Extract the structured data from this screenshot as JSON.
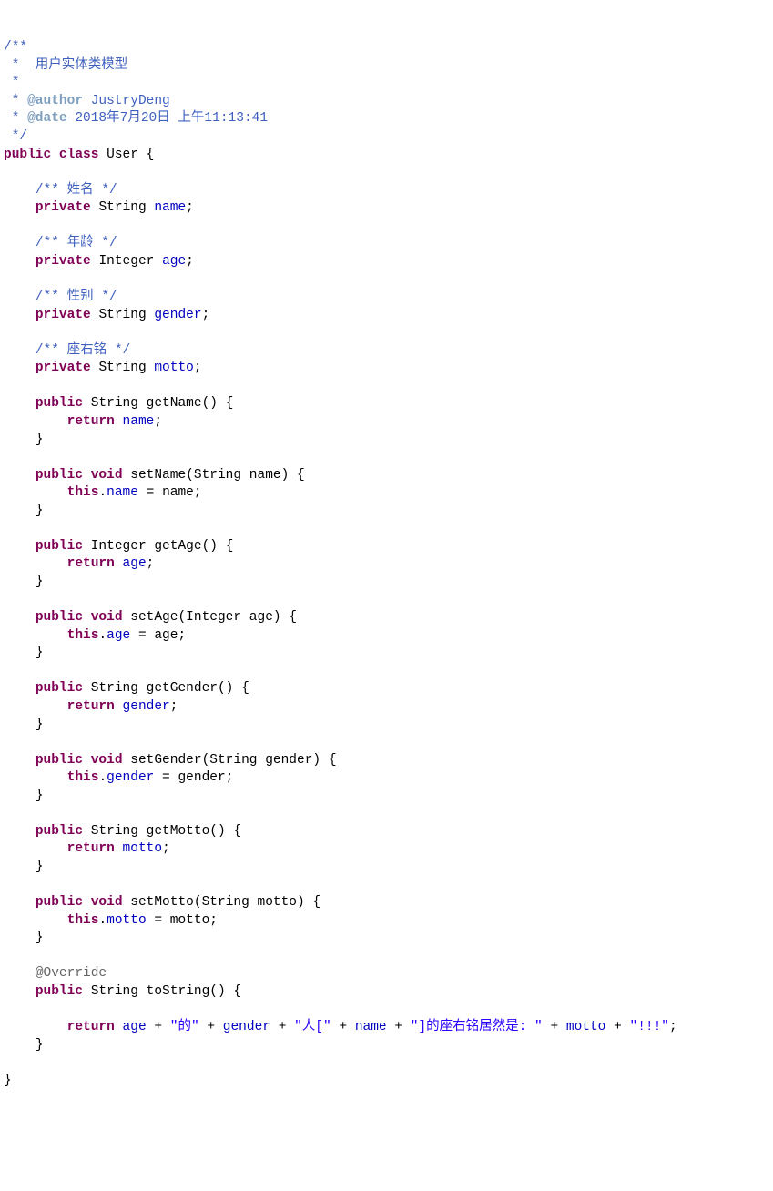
{
  "doc": {
    "open": "/**",
    "desc": " *  用户实体类模型",
    "blank": " *",
    "authorTag": "@author",
    "authorVal": " JustryDeng",
    "dateTag": "@date",
    "dateVal": " 2018年7月20日 上午11:13:41",
    "close": " */"
  },
  "kw": {
    "public": "public",
    "class": "class",
    "private": "private",
    "void": "void",
    "return": "return",
    "this": "this"
  },
  "cls": "User",
  "types": {
    "String": "String",
    "Integer": "Integer"
  },
  "fields": {
    "nameComment": "/** 姓名 */",
    "name": "name",
    "ageComment": "/** 年龄 */",
    "age": "age",
    "genderComment": "/** 性别 */",
    "gender": "gender",
    "mottoComment": "/** 座右铭 */",
    "motto": "motto"
  },
  "methods": {
    "getName": "getName",
    "setName": "setName",
    "getAge": "getAge",
    "setAge": "setAge",
    "getGender": "getGender",
    "setGender": "setGender",
    "getMotto": "getMotto",
    "setMotto": "setMotto",
    "toString": "toString"
  },
  "params": {
    "name": "name",
    "age": "age",
    "gender": "gender",
    "motto": "motto"
  },
  "annot": {
    "override": "@Override"
  },
  "strs": {
    "de": "\"的\"",
    "ren": "\"人[\"",
    "close": "\"]的座右铭居然是: \"",
    "bang": "\"!!!\""
  },
  "punct": {
    "obrace": " {",
    "cbrace": "}",
    "sc": ";",
    "op": "(",
    "cp": ")",
    "eq": " = ",
    "dot": ".",
    "plus": " + "
  }
}
